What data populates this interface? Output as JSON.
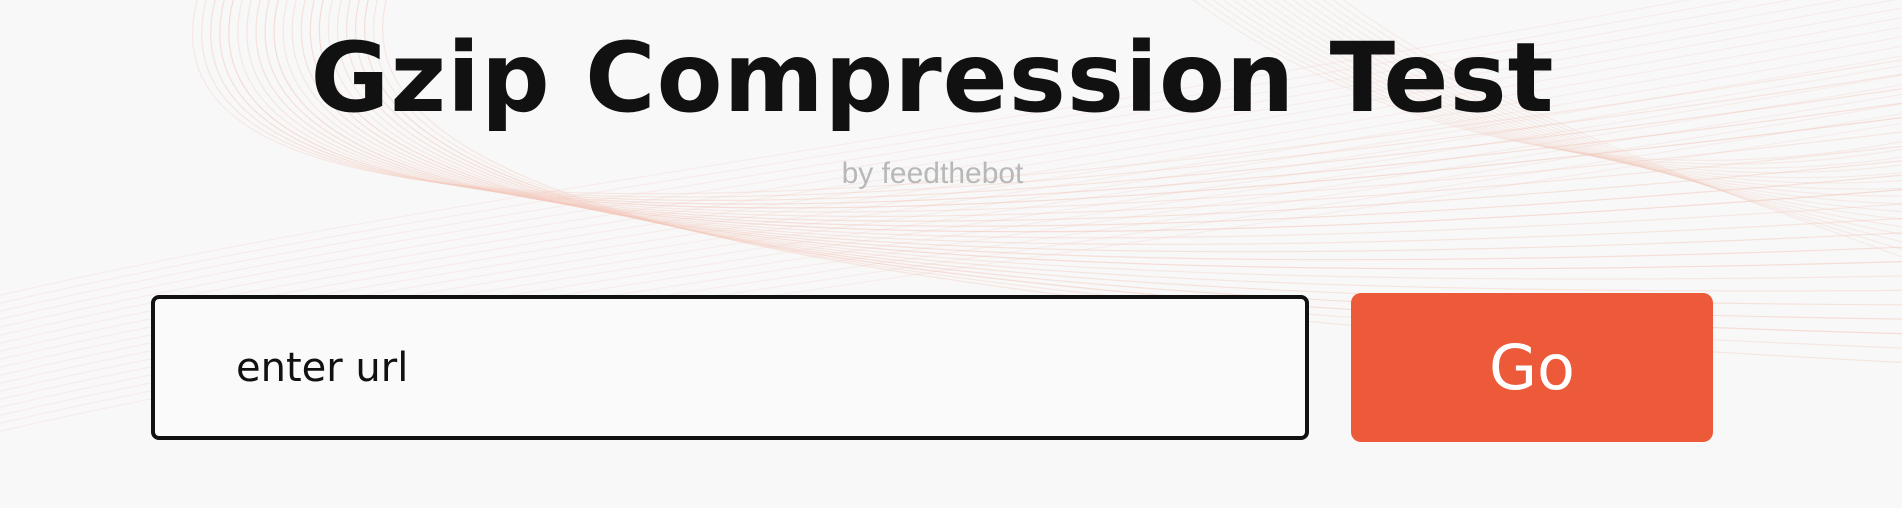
{
  "header": {
    "title": "Gzip Compression Test",
    "byline": "by feedthebot"
  },
  "form": {
    "url_placeholder": "enter url",
    "url_value": "",
    "go_label": "Go"
  },
  "colors": {
    "accent": "#ec5a3a",
    "background": "#f8f8f8",
    "title_text": "#111111",
    "byline_text": "#b8b8b8",
    "decoration_lines": "#f3c9bc"
  }
}
